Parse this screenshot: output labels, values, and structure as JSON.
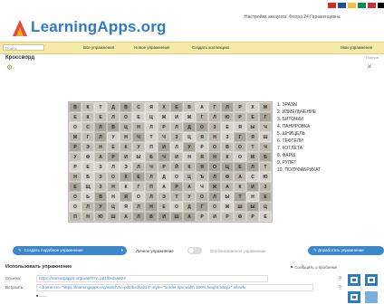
{
  "header": {
    "brand": "LearningApps.org",
    "account_text": "Настройки аккаунта: Флора 24 Гараженцевна",
    "flag_colors": [
      "#d52b1e",
      "#1f4fa3",
      "#f4c430",
      "#009246",
      "#ce2b37",
      "#000000"
    ]
  },
  "nav": {
    "search_placeholder": "Поиск",
    "items": [
      "Все упражнения",
      "Новое упражнение",
      "Создать коллекцию",
      "Мои упражнения"
    ]
  },
  "page": {
    "title": "Кроссворд",
    "fullscreen_label": "Полное"
  },
  "puzzle": {
    "background_colors": [
      "#a9a39a",
      "#bdb7ad",
      "#d7d3cc",
      "#c4c0b8"
    ],
    "rows": [
      "ВКТДВСЯХЕВАГЛРХМ",
      "ЕКЕЛОЕЦЖИЖГЛЮРЕГ",
      "ОСЛВЦНЛРЛДОЗЕЯЫЧ",
      "ЖГЛУНЧТЧЗЦЯНЗГЯШ",
      "РЭНЕКУПИЛУРОВОТЧ",
      "УФАРИЫБЧИНЯНКОМБ",
      "РЕЗЛЭЛЧРЙКЯОЦЕЛТ",
      "НБЗОКЕЛДОЦЪЛФАСЮ",
      "ЕЩЗНКГПАРАЧЖАКИЗ",
      "ОЬВНЯОЛЭТУОЛЫТНЕ",
      "ОЛУЦЯЛНЕОДГОЖШЫЦ",
      "ПНЮШАЛВИШАРИРФРЕ"
    ]
  },
  "words": [
    "1. ЗРАЗЫ",
    "2. ИЗМЕЛЬЧЕНИЕ",
    "3. БИТОЧКИ",
    "4. ПАНИРОВКА",
    "5. ШНИЦЕЛЬ",
    "6. ТЕФТЕЛИ",
    "7. КОТЛЕТА",
    "8. ФАРШ",
    "9. РУЛЕТ",
    "10. ПОЛУФАБРИКАТ"
  ],
  "toolbar": {
    "create_label": "Создать подобное упражнение",
    "private_label": "Личное упражнение",
    "public_label": "Опубликованное упражнение",
    "improve_label": "Доработать упражнение"
  },
  "use": {
    "title": "Использовать упражнение",
    "report_label": "Сообщить о проблеме",
    "link_label": "Ссылка:",
    "link_value": "https://learningapps.org/watch?v=pd1fbsdsa224",
    "embed_label": "Встроить:",
    "embed_value": "<iframe src=\"https://learningapps.org/watch?v=pd1fbsdsa224\" style=\"border:0px;width:100%;height:500px\" allowfu"
  }
}
